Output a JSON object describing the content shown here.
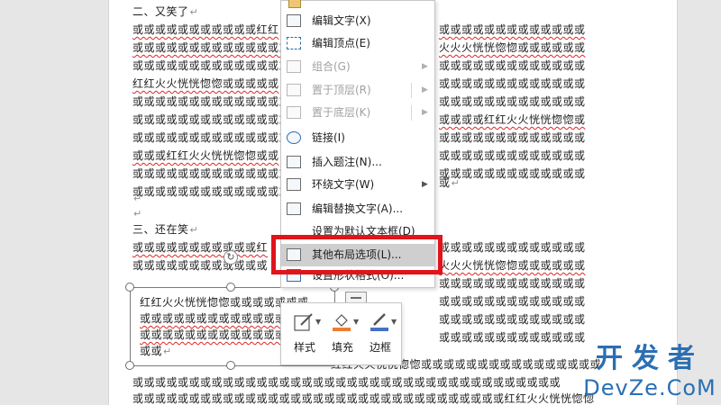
{
  "document": {
    "heading2": "二、又笑了",
    "heading3": "三、还在笑",
    "paragraph_mark": "↵",
    "lines": [
      "或或或或或或或或或或或红红",
      "或或或或或或或或或或或或或或",
      "或或或或或或或或或或或或或或",
      "红红火火恍恍惚惚或或或或或",
      "或或或或或或或或或或或或或或",
      "或或或或或或或或或或或或或或",
      "或或或或或或或或或或或或或或",
      "或或或红红火火恍恍惚惚或或",
      "或或或或或或或或或或或或或或",
      "或或或或或或或或或或或或或或"
    ],
    "lines_right": [
      "或或或或或或或或或或或或或",
      "火火火恍恍惚惚或或或或或或",
      "或或或或或或或或或或或或或",
      "或或或或或或或或或或或或或",
      "或或或或或或或或或或或或或",
      "或或或或红红火火恍恍惚惚或",
      "或或或或或或或或或或或或或",
      "或或或或或或或或或或或或或",
      "或或或或或或或或或或或或或",
      "或"
    ],
    "lines_below": [
      "或或或或或或或或或或或红",
      "或或或或或或或或或或或或"
    ],
    "lines_below_right": [
      "或或或或或或或或或或或或或",
      "火火火恍恍惚惚或或或或或或"
    ],
    "lines_bottom": [
      "或或或或或或或或或或或或或或或或或或或或或或或或或或或或或或或或或或或或或或",
      "或或或或或或或或或或或或或或或或或或或或或或或或或或或或或或或或或红红火火恍恍惚惚"
    ],
    "bottom_right_line": "红红火火恍恍惚惚或或或或或或或或或或或或或或或或"
  },
  "textbox": {
    "lines": [
      "红红火火恍恍惚惚或或或或或或或",
      "或或或或或或或或或或或或或或",
      "或或或或或或或或或或或或或或",
      "或或"
    ]
  },
  "context_menu": {
    "items": [
      {
        "label": "编辑文字(X)",
        "disabled": false,
        "submenu": false
      },
      {
        "label": "编辑顶点(E)",
        "disabled": false,
        "submenu": false
      },
      {
        "label": "组合(G)",
        "disabled": true,
        "submenu": true
      },
      {
        "label": "置于顶层(R)",
        "disabled": true,
        "submenu": true
      },
      {
        "label": "置于底层(K)",
        "disabled": true,
        "submenu": true
      },
      {
        "label": "链接(I)",
        "disabled": false,
        "submenu": false
      },
      {
        "label": "插入题注(N)...",
        "disabled": false,
        "submenu": false
      },
      {
        "label": "环绕文字(W)",
        "disabled": false,
        "submenu": true
      },
      {
        "label": "编辑替换文字(A)...",
        "disabled": false,
        "submenu": false
      },
      {
        "label": "设置为默认文本框(D)",
        "disabled": false,
        "submenu": false
      },
      {
        "label": "其他布局选项(L)...",
        "disabled": false,
        "submenu": false,
        "highlighted": true
      },
      {
        "label": "设置形状格式(O)...",
        "disabled": false,
        "submenu": false
      }
    ]
  },
  "mini_toolbar": {
    "style_label": "样式",
    "fill_label": "填充",
    "border_label": "边框"
  },
  "colors": {
    "highlight_border": "#e0141a",
    "fill_accent": "#ed7d31",
    "border_accent": "#4472c4",
    "squiggle": "#e02424",
    "watermark": "#2b6fb3"
  },
  "watermark": {
    "top": "开发者",
    "bottom": "DevZe.CoM"
  }
}
